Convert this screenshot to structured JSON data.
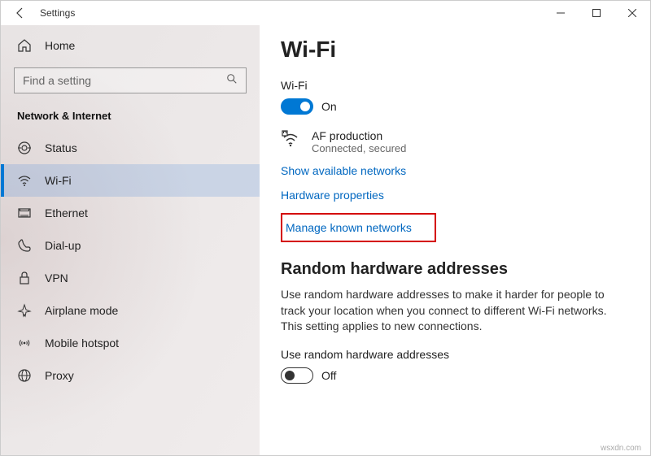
{
  "titlebar": {
    "title": "Settings"
  },
  "sidebar": {
    "home_label": "Home",
    "search_placeholder": "Find a setting",
    "category": "Network & Internet",
    "items": [
      {
        "label": "Status"
      },
      {
        "label": "Wi-Fi"
      },
      {
        "label": "Ethernet"
      },
      {
        "label": "Dial-up"
      },
      {
        "label": "VPN"
      },
      {
        "label": "Airplane mode"
      },
      {
        "label": "Mobile hotspot"
      },
      {
        "label": "Proxy"
      }
    ]
  },
  "main": {
    "page_title": "Wi-Fi",
    "wifi_label": "Wi-Fi",
    "wifi_toggle_label": "On",
    "network": {
      "name": "AF production",
      "status": "Connected, secured"
    },
    "link_show_networks": "Show available networks",
    "link_hw_props": "Hardware properties",
    "link_manage_known": "Manage known networks",
    "random_hw_heading": "Random hardware addresses",
    "random_hw_desc": "Use random hardware addresses to make it harder for people to track your location when you connect to different Wi-Fi networks. This setting applies to new connections.",
    "random_hw_toggle_title": "Use random hardware addresses",
    "random_hw_toggle_label": "Off"
  },
  "watermark": "wsxdn.com"
}
